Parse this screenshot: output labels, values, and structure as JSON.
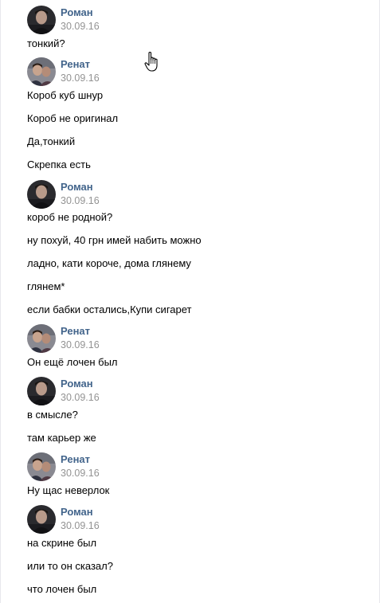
{
  "messages": [
    {
      "author": "Роман",
      "date": "30.09.16",
      "avatar": "roman",
      "lines": [
        "тонкий?"
      ]
    },
    {
      "author": "Ренат",
      "date": "30.09.16",
      "avatar": "renat",
      "lines": [
        "Короб куб шнур",
        "Короб не оригинал",
        "Да,тонкий",
        "Скрепка есть"
      ]
    },
    {
      "author": "Роман",
      "date": "30.09.16",
      "avatar": "roman",
      "lines": [
        "короб не родной?",
        "ну похуй, 40 грн имей набить можно",
        "ладно, кати короче, дома глянему",
        "глянем*",
        "если бабки остались,Купи сигарет"
      ]
    },
    {
      "author": "Ренат",
      "date": "30.09.16",
      "avatar": "renat",
      "lines": [
        "Он ещё лочен был"
      ]
    },
    {
      "author": "Роман",
      "date": "30.09.16",
      "avatar": "roman",
      "lines": [
        "в смысле?",
        "там карьер же"
      ]
    },
    {
      "author": "Ренат",
      "date": "30.09.16",
      "avatar": "renat",
      "lines": [
        "Ну щас неверлок"
      ]
    },
    {
      "author": "Роман",
      "date": "30.09.16",
      "avatar": "roman",
      "lines": [
        "на скрине был",
        "или то он сказал?",
        "что лочен был"
      ]
    }
  ],
  "icons": {
    "cursor": "hand-pointer-icon",
    "avatar_roman": "user-avatar-photo",
    "avatar_renat": "user-avatar-photo"
  },
  "colors": {
    "author": "#42648b",
    "date": "#939393",
    "text": "#000000"
  }
}
